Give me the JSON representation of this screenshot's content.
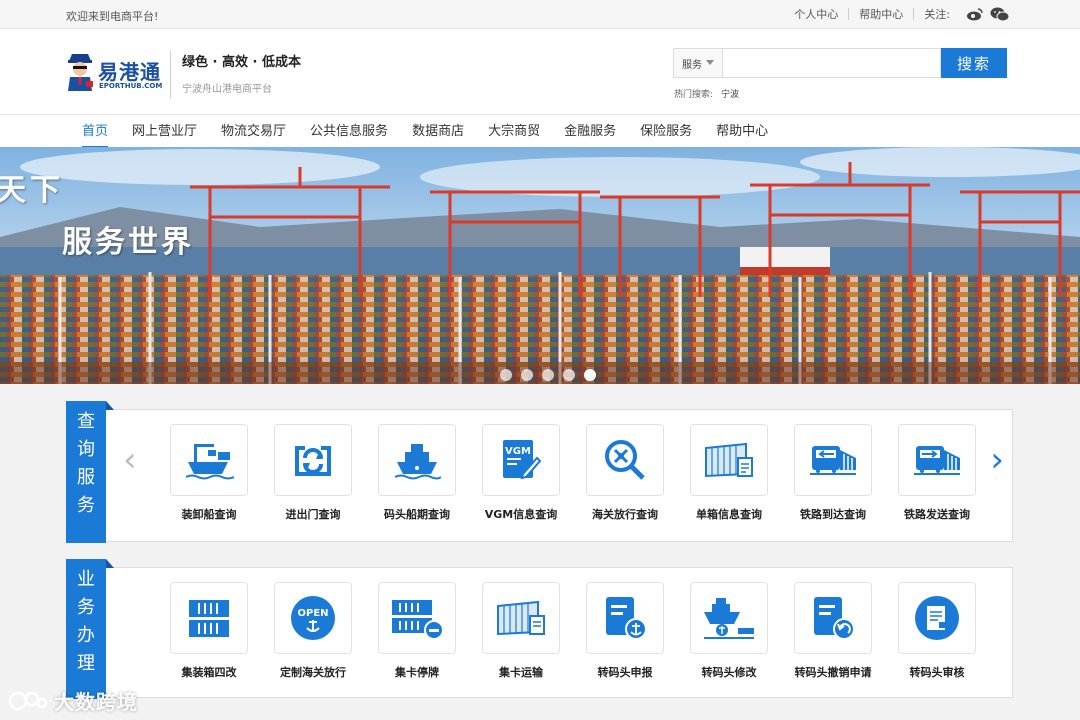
{
  "topbar": {
    "welcome": "欢迎来到电商平台!",
    "personal_center": "个人中心",
    "help_center": "帮助中心",
    "follow": "关注:",
    "social_icons": [
      "weibo-icon",
      "wechat-icon"
    ]
  },
  "header": {
    "logo_text": "易港通",
    "logo_sub": "EPORTHUB.COM",
    "slogan": "绿色 · 高效 · 低成本",
    "slogan_sub": "宁波舟山港电商平台",
    "search": {
      "scope": "服务",
      "value": "",
      "button": "搜索",
      "hot_label": "热门搜索:",
      "hot_keyword": "宁波"
    }
  },
  "nav": {
    "items": [
      "首页",
      "网上营业厅",
      "物流交易厅",
      "公共信息服务",
      "数据商店",
      "大宗商贸",
      "金融服务",
      "保险服务",
      "帮助中心"
    ],
    "active_index": 0
  },
  "banner": {
    "line1": "天下",
    "line2": "服务世界",
    "slide_count": 5,
    "active_slide": 4
  },
  "query_services": {
    "tag": [
      "查",
      "询",
      "服",
      "务"
    ],
    "items": [
      {
        "label": "装卸船查询",
        "icon": "ship-loading-icon"
      },
      {
        "label": "进出门查询",
        "icon": "gate-in-out-icon"
      },
      {
        "label": "码头船期查询",
        "icon": "ship-schedule-icon"
      },
      {
        "label": "VGM信息查询",
        "icon": "vgm-icon"
      },
      {
        "label": "海关放行查询",
        "icon": "customs-release-icon"
      },
      {
        "label": "单箱信息查询",
        "icon": "container-info-icon"
      },
      {
        "label": "铁路到达查询",
        "icon": "rail-arrival-icon"
      },
      {
        "label": "铁路发送查询",
        "icon": "rail-departure-icon"
      }
    ]
  },
  "business_services": {
    "tag": [
      "业",
      "务",
      "办",
      "理"
    ],
    "items": [
      {
        "label": "集装箱四改",
        "icon": "container-change-icon"
      },
      {
        "label": "定制海关放行",
        "icon": "custom-release-icon"
      },
      {
        "label": "集卡停牌",
        "icon": "truck-suspend-icon"
      },
      {
        "label": "集卡运输",
        "icon": "truck-transport-icon"
      },
      {
        "label": "转码头申报",
        "icon": "transfer-declare-icon"
      },
      {
        "label": "转码头修改",
        "icon": "transfer-modify-icon"
      },
      {
        "label": "转码头撤销申请",
        "icon": "transfer-revoke-icon"
      },
      {
        "label": "转码头审核",
        "icon": "transfer-review-icon"
      }
    ]
  },
  "watermark": "大数跨境",
  "colors": {
    "accent": "#1a7ad6",
    "icon": "#1a7ad6"
  }
}
